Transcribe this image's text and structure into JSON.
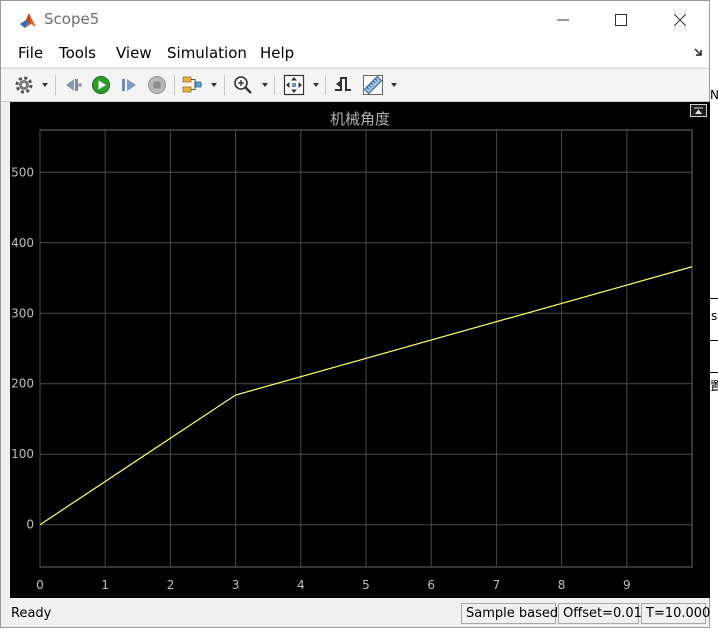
{
  "window": {
    "title": "Scope5"
  },
  "menu": [
    "File",
    "Tools",
    "View",
    "Simulation",
    "Help"
  ],
  "toolbar": [
    {
      "icon": "settings-gear-icon"
    },
    {
      "icon": "step-back-icon"
    },
    {
      "icon": "run-icon"
    },
    {
      "icon": "step-forward-icon"
    },
    {
      "icon": "stop-icon"
    },
    {
      "icon": "highlight-signal-icon"
    },
    {
      "icon": "zoom-in-icon"
    },
    {
      "icon": "fit-to-view-icon"
    },
    {
      "icon": "triggers-icon"
    },
    {
      "icon": "measurements-icon"
    }
  ],
  "chart_data": {
    "type": "line",
    "title": "机械角度",
    "xlabel": "",
    "ylabel": "",
    "xlim": [
      0,
      10
    ],
    "ylim": [
      -60,
      560
    ],
    "x_ticks": [
      0,
      1,
      2,
      3,
      4,
      5,
      6,
      7,
      8,
      9
    ],
    "y_ticks": [
      0,
      100,
      200,
      300,
      400,
      500
    ],
    "grid": true,
    "background": "#000000",
    "grid_color": "#4a4a4a",
    "tick_label_color": "#bdbdbd",
    "series": [
      {
        "color": "#ffff66",
        "x": [
          0,
          3,
          10
        ],
        "y": [
          0,
          184,
          366
        ]
      }
    ]
  },
  "status": {
    "ready": "Ready",
    "sample_mode": "Sample based",
    "offset": "Offset=0.01",
    "time": "T=10.000"
  },
  "background_fragments": [
    "N",
    "s",
    "置"
  ]
}
